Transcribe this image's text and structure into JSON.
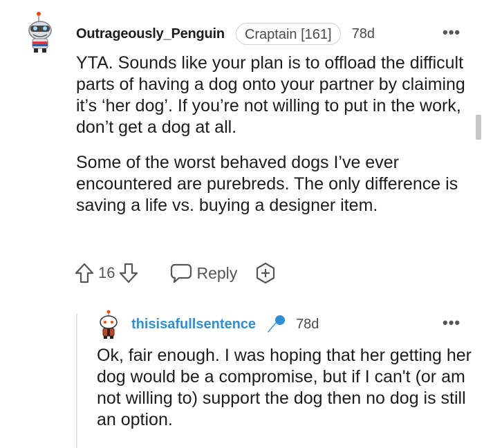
{
  "comment": {
    "username": "Outrageously_Penguin",
    "flair": "Craptain [161]",
    "timestamp": "78d",
    "more_label": "•••",
    "paragraphs": [
      "YTA. Sounds like your plan is to offload the difficult parts of having a dog onto your partner by claiming it’s ‘her dog’. If you’re not willing to put in the work, don’t get a dog at all.",
      "Some of the worst behaved dogs I’ve ever encountered are purebreds. The only difference is saving a life vs. buying a designer item."
    ],
    "score": "16",
    "reply_label": "Reply",
    "icons": [
      "avatar",
      "upvote-icon",
      "downvote-icon",
      "reply-icon",
      "award-icon",
      "more-icon"
    ]
  },
  "reply": {
    "username": "thisisafullsentence",
    "timestamp": "78d",
    "more_label": "•••",
    "text": "Ok, fair enough. I was hoping that her getting her dog would be a compromise, but if I can't (or am not willing to) support the dog then no dog is still an option.",
    "icons": [
      "avatar",
      "microphone-icon",
      "more-icon"
    ]
  },
  "colors": {
    "username_reply": "#2f8fd6",
    "text": "#1c1c1c",
    "meta": "#4a4a4a"
  }
}
